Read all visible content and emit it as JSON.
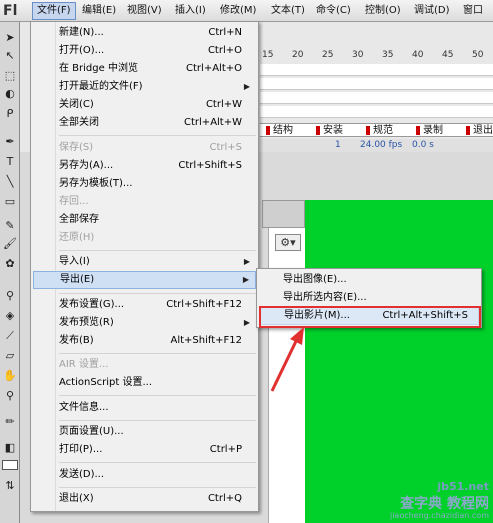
{
  "app": {
    "logo": "Fl"
  },
  "menubar": {
    "items": [
      {
        "label": "文件(F)"
      },
      {
        "label": "编辑(E)"
      },
      {
        "label": "视图(V)"
      },
      {
        "label": "插入(I)"
      },
      {
        "label": "修改(M)"
      },
      {
        "label": "文本(T)"
      },
      {
        "label": "命令(C)"
      },
      {
        "label": "控制(O)"
      },
      {
        "label": "调试(D)"
      },
      {
        "label": "窗口"
      }
    ]
  },
  "timeline": {
    "ruler": [
      "15",
      "20",
      "25",
      "30",
      "35",
      "40",
      "45",
      "50"
    ],
    "scenes": [
      "结构",
      "安装",
      "规范",
      "录制",
      "退出"
    ],
    "status": {
      "fps": "24.00 fps",
      "time": "0.0 s",
      "frame": "1"
    }
  },
  "file_menu": {
    "items": [
      {
        "label": "新建(N)...",
        "shortcut": "Ctrl+N"
      },
      {
        "label": "打开(O)...",
        "shortcut": "Ctrl+O"
      },
      {
        "label": "在 Bridge 中浏览",
        "shortcut": "Ctrl+Alt+O"
      },
      {
        "label": "打开最近的文件(F)",
        "shortcut": ""
      },
      {
        "label": "关闭(C)",
        "shortcut": "Ctrl+W"
      },
      {
        "label": "全部关闭",
        "shortcut": "Ctrl+Alt+W"
      },
      {
        "label": "保存(S)",
        "shortcut": "Ctrl+S"
      },
      {
        "label": "另存为(A)...",
        "shortcut": "Ctrl+Shift+S"
      },
      {
        "label": "另存为模板(T)...",
        "shortcut": ""
      },
      {
        "label": "存回...",
        "shortcut": ""
      },
      {
        "label": "全部保存",
        "shortcut": ""
      },
      {
        "label": "还原(H)",
        "shortcut": ""
      },
      {
        "label": "导入(I)",
        "shortcut": ""
      },
      {
        "label": "导出(E)",
        "shortcut": ""
      },
      {
        "label": "发布设置(G)...",
        "shortcut": "Ctrl+Shift+F12"
      },
      {
        "label": "发布预览(R)",
        "shortcut": ""
      },
      {
        "label": "发布(B)",
        "shortcut": "Alt+Shift+F12"
      },
      {
        "label": "AIR 设置...",
        "shortcut": ""
      },
      {
        "label": "ActionScript 设置...",
        "shortcut": ""
      },
      {
        "label": "文件信息...",
        "shortcut": ""
      },
      {
        "label": "页面设置(U)...",
        "shortcut": ""
      },
      {
        "label": "打印(P)...",
        "shortcut": "Ctrl+P"
      },
      {
        "label": "发送(D)...",
        "shortcut": ""
      },
      {
        "label": "退出(X)",
        "shortcut": "Ctrl+Q"
      }
    ]
  },
  "export_submenu": {
    "items": [
      {
        "label": "导出图像(E)...",
        "shortcut": ""
      },
      {
        "label": "导出所选内容(E)...",
        "shortcut": ""
      },
      {
        "label": "导出影片(M)...",
        "shortcut": "Ctrl+Alt+Shift+S"
      }
    ]
  },
  "watermark": {
    "line1": "jb51.net",
    "line2": "查字典 教程网",
    "line3": "jiaocheng.chazidian.com"
  },
  "colors": {
    "stage_green": "#00d12a",
    "highlight_red": "#e03030",
    "menu_highlight": "#cfe0f5"
  },
  "icons": [
    "selection-tool-icon",
    "subselection-tool-icon",
    "free-transform-icon",
    "lasso-icon",
    "pen-icon",
    "text-tool-icon",
    "line-tool-icon",
    "rectangle-tool-icon",
    "pencil-icon",
    "brush-icon",
    "deco-icon",
    "bone-icon",
    "paint-bucket-icon",
    "eyedropper-icon",
    "eraser-icon",
    "hand-icon",
    "zoom-icon",
    "stroke-color-icon",
    "fill-color-icon",
    "gear-icon",
    "submenu-arrow-icon",
    "red-arrow-icon"
  ]
}
